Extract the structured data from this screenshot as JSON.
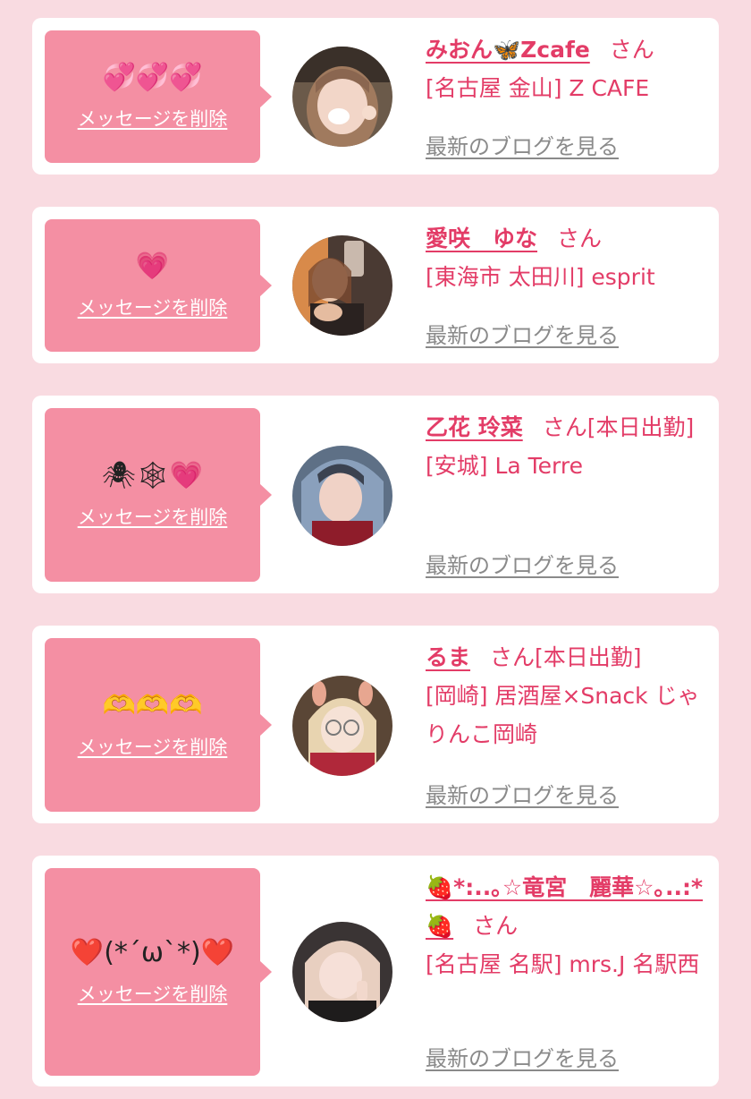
{
  "colors": {
    "page_bg": "#f9dbe1",
    "card_bg": "#ffffff",
    "bubble_bg": "#f48fa3",
    "accent_text": "#e33c67",
    "link_gray": "#8a8a8a"
  },
  "items": [
    {
      "message": "💞💞💞",
      "delete_label": "メッセージを削除",
      "name": "みおん🦋Zcafe",
      "honorific": "さん",
      "status": "",
      "shop": "[名古屋 金山] Z CAFE",
      "blog_label": "最新のブログを見る"
    },
    {
      "message": "💗",
      "delete_label": "メッセージを削除",
      "name": "愛咲　ゆな",
      "honorific": "さん",
      "status": "",
      "shop": "[東海市 太田川] esprit",
      "blog_label": "最新のブログを見る"
    },
    {
      "message": "🕷🕸💗",
      "delete_label": "メッセージを削除",
      "name": "乙花 玲菜",
      "honorific": "さん",
      "status": "[本日出勤]",
      "shop": "[安城] La Terre",
      "blog_label": "最新のブログを見る"
    },
    {
      "message": "🫶🫶🫶",
      "delete_label": "メッセージを削除",
      "name": "るま",
      "honorific": "さん",
      "status": "[本日出勤]",
      "shop": "[岡崎] 居酒屋×Snack じゃりんこ岡崎",
      "blog_label": "最新のブログを見る"
    },
    {
      "message": "❤️(*´ω`*)❤️",
      "delete_label": "メッセージを削除",
      "name": "🍓*:..｡☆竜宮　麗華☆｡..:*🍓",
      "honorific": "さん",
      "status": "",
      "shop": "[名古屋 名駅] mrs.J 名駅西",
      "blog_label": "最新のブログを見る"
    }
  ]
}
